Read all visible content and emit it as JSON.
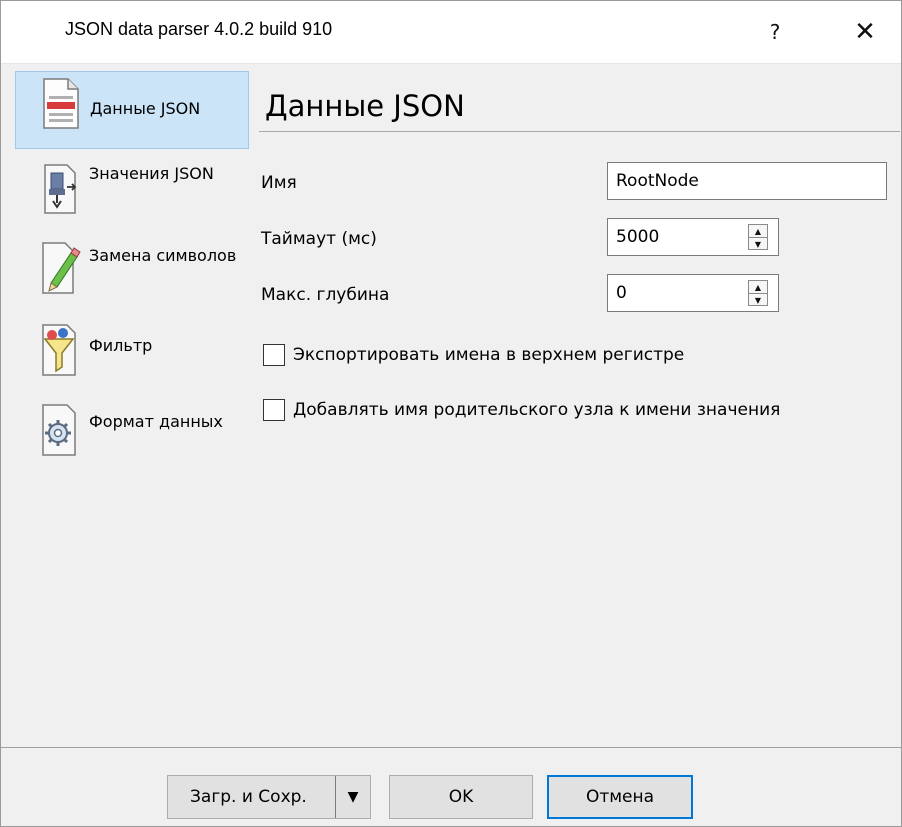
{
  "window": {
    "title": "JSON data parser 4.0.2 build 910",
    "help_glyph": "?",
    "close_glyph": "✕"
  },
  "sidebar": {
    "items": [
      {
        "label": "Данные JSON",
        "icon": "document-icon",
        "active": true
      },
      {
        "label": "Значения JSON",
        "icon": "connector-icon",
        "active": false
      },
      {
        "label": "Замена символов",
        "icon": "pencil-edit-icon",
        "active": false
      },
      {
        "label": "Фильтр",
        "icon": "filter-funnel-icon",
        "active": false
      },
      {
        "label": "Формат данных",
        "icon": "gear-format-icon",
        "active": false
      }
    ]
  },
  "panel": {
    "title": "Данные JSON",
    "name_label": "Имя",
    "name_value": "RootNode",
    "timeout_label": "Таймаут (мс)",
    "timeout_value": "5000",
    "depth_label": "Макс. глубина",
    "depth_value": "0",
    "uppercase_label": "Экспортировать имена в верхнем регистре",
    "uppercase_checked": false,
    "parent_label": "Добавлять имя родительского узла к имени значения",
    "parent_checked": false
  },
  "footer": {
    "load_save_label": "Загр. и Сохр.",
    "ok_label": "OK",
    "cancel_label": "Отмена"
  }
}
